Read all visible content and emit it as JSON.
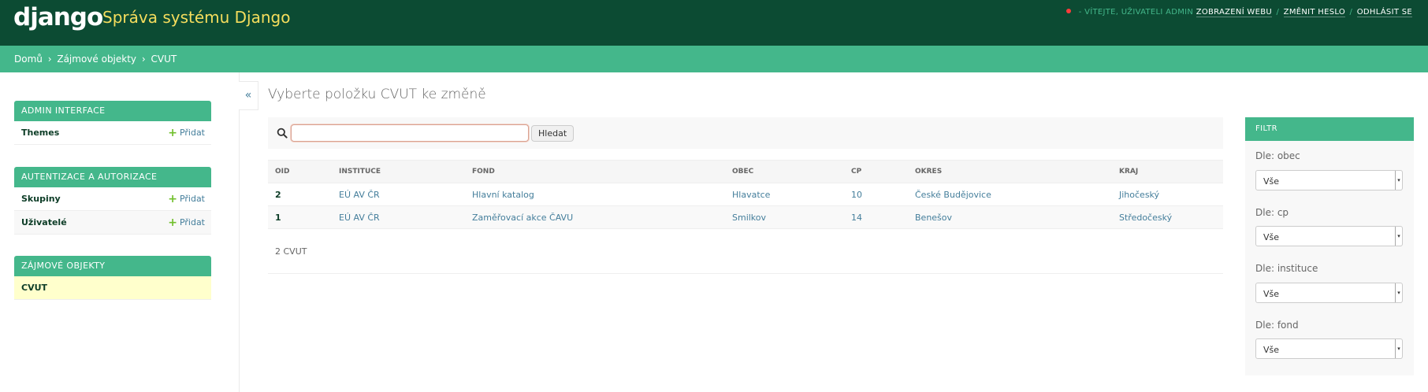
{
  "header": {
    "logo": "django",
    "site_name": "Správa systému Django",
    "welcome": "VÍTEJTE, UŽIVATELI",
    "username": "ADMIN",
    "links": {
      "view_site": "ZOBRAZENÍ WEBU",
      "change_password": "ZMĚNIT HESLO",
      "logout": "ODHLÁSIT SE"
    },
    "separator": "/",
    "indicator_color": "#ff3b3b"
  },
  "breadcrumbs": {
    "home": "Domů",
    "app": "Zájmové objekty",
    "current": "CVUT",
    "arrow": "›"
  },
  "sidebar": {
    "toggle": "«",
    "apps": [
      {
        "caption": "ADMIN INTERFACE",
        "models": [
          {
            "name": "Themes",
            "add": "Přidat"
          }
        ]
      },
      {
        "caption": "AUTENTIZACE A AUTORIZACE",
        "models": [
          {
            "name": "Skupiny",
            "add": "Přidat"
          },
          {
            "name": "Uživatelé",
            "add": "Přidat"
          }
        ]
      },
      {
        "caption": "ZÁJMOVÉ OBJEKTY",
        "models": [
          {
            "name": "CVUT"
          }
        ]
      }
    ]
  },
  "content": {
    "title": "Vyberte položku CVUT ke změně",
    "search": {
      "value": "",
      "button": "Hledat"
    },
    "table": {
      "columns": [
        "OID",
        "INSTITUCE",
        "FOND",
        "OBEC",
        "CP",
        "OKRES",
        "KRAJ"
      ],
      "rows": [
        [
          "2",
          "EÚ AV ČR",
          "Hlavní katalog",
          "Hlavatce",
          "10",
          "České Budějovice",
          "Jihočeský"
        ],
        [
          "1",
          "EÚ AV ČR",
          "Zaměřovací akce ČAVU",
          "Smilkov",
          "14",
          "Benešov",
          "Středočeský"
        ]
      ]
    },
    "paginator": "2 CVUT"
  },
  "filter": {
    "title": "FILTR",
    "groups": [
      {
        "label": "Dle: obec",
        "selected": "Vše"
      },
      {
        "label": "Dle: cp",
        "selected": "Vše"
      },
      {
        "label": "Dle: instituce",
        "selected": "Vše"
      },
      {
        "label": "Dle: fond",
        "selected": "Vše"
      }
    ]
  },
  "colors": {
    "header_bg": "#0c4b33",
    "accent": "#44b78b",
    "site_name": "#f5dd5d",
    "link": "#447e9b",
    "current_row": "#ffffcc"
  }
}
